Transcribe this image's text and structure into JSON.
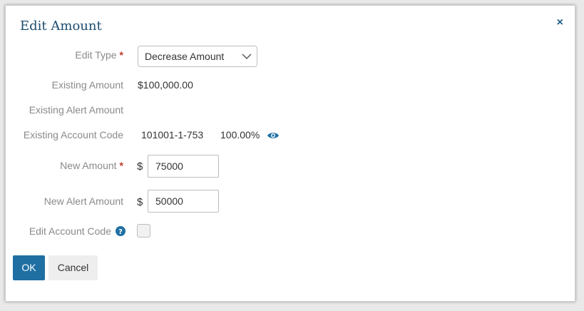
{
  "dialog": {
    "title": "Edit Amount",
    "close_symbol": "×"
  },
  "form": {
    "edit_type": {
      "label": "Edit Type",
      "required_marker": "*",
      "selected_value": "Decrease Amount"
    },
    "existing_amount": {
      "label": "Existing Amount",
      "value": "$100,000.00"
    },
    "existing_alert_amount": {
      "label": "Existing Alert Amount",
      "value": ""
    },
    "existing_account_code": {
      "label": "Existing Account Code",
      "code": "101001-1-753",
      "percent": "100.00%",
      "icon": "eye-icon"
    },
    "new_amount": {
      "label": "New Amount",
      "required_marker": "*",
      "currency": "$",
      "value": "75000"
    },
    "new_alert_amount": {
      "label": "New Alert Amount",
      "currency": "$",
      "value": "50000"
    },
    "edit_account_code": {
      "label": "Edit Account Code",
      "help_icon": "question-circle-icon",
      "checked": false
    }
  },
  "buttons": {
    "ok_label": "OK",
    "cancel_label": "Cancel"
  },
  "colors": {
    "primary": "#1f6fa3",
    "title": "#1d4d6e",
    "label": "#8a8a8a",
    "required": "#c0392b"
  }
}
